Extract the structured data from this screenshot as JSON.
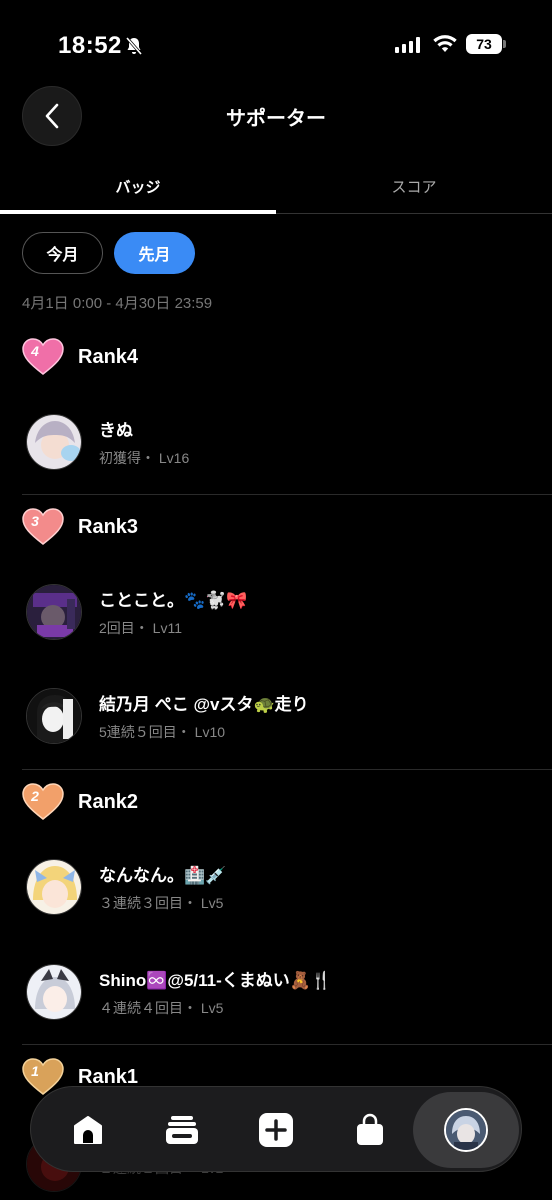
{
  "status": {
    "time": "18:52",
    "battery": "73"
  },
  "header": {
    "title": "サポーター"
  },
  "tabs": [
    {
      "label": "バッジ"
    },
    {
      "label": "スコア"
    }
  ],
  "period": {
    "current_label": "今月",
    "previous_label": "先月",
    "range": "4月1日 0:00 - 4月30日 23:59"
  },
  "ranks": [
    {
      "label": "Rank4",
      "number": "4",
      "color": "#f06fa8",
      "members": [
        {
          "name": "きぬ",
          "sub": "初獲得・ Lv16"
        }
      ]
    },
    {
      "label": "Rank3",
      "number": "3",
      "color": "#f38b8b",
      "members": [
        {
          "name": "ことこと。🐾🐩🎀",
          "sub": "2回目・ Lv11"
        },
        {
          "name": "結乃月 ぺこ @vスタ🐢走り",
          "sub": "5連続５回目・ Lv10"
        }
      ]
    },
    {
      "label": "Rank2",
      "number": "2",
      "color": "#f2a06a",
      "members": [
        {
          "name": "なんなん。🏥💉",
          "sub": "３連続３回目・ Lv5"
        },
        {
          "name": "Shino♾️@5/11-くまぬい🧸🍴",
          "sub": "４連続４回目・ Lv5"
        }
      ]
    },
    {
      "label": "Rank1",
      "number": "1",
      "color": "#d9a25a",
      "members": [
        {
          "name": "",
          "sub": "２連続２回目・ Lv2"
        }
      ]
    }
  ],
  "nav": {
    "items": [
      "home-icon",
      "cards-icon",
      "plus-icon",
      "bag-icon",
      "profile-avatar"
    ]
  }
}
